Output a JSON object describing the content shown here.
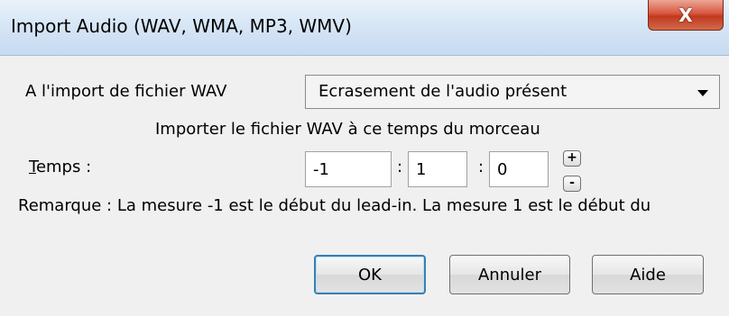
{
  "window": {
    "title": "Import Audio (WAV, WMA, MP3, WMV)",
    "close_glyph": "X"
  },
  "form": {
    "import_label": "A l'import de fichier WAV",
    "mode_select": {
      "selected": "Ecrasement de l'audio présent"
    },
    "time_caption": "Importer le fichier WAV à ce temps du morceau",
    "time_label_accel": "T",
    "time_label_rest": "emps :",
    "time_fields": [
      "-1",
      "1",
      "0"
    ],
    "separator": ":",
    "spin_up": "+",
    "spin_down": "-",
    "note": "Remarque : La mesure -1 est le début du lead-in. La mesure 1 est le début du"
  },
  "buttons": {
    "ok": "OK",
    "cancel": "Annuler",
    "help": "Aide"
  }
}
